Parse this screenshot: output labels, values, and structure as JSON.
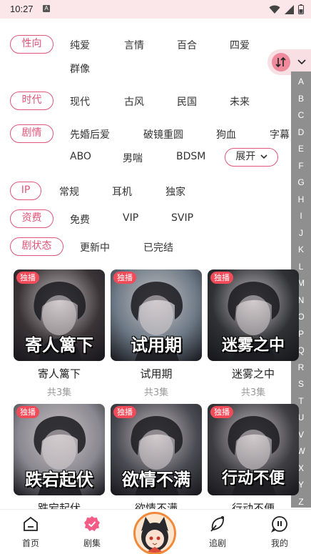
{
  "status_bar": {
    "time": "10:27",
    "notif_icon": "A"
  },
  "filters": {
    "orientation": {
      "label": "性向",
      "options": [
        "纯爱",
        "言情",
        "百合",
        "四爱",
        "群像"
      ]
    },
    "era": {
      "label": "时代",
      "options": [
        "现代",
        "古风",
        "民国",
        "未来"
      ]
    },
    "plot": {
      "label": "剧情",
      "options": [
        "先婚后爱",
        "破镜重圆",
        "狗血",
        "字幕",
        "ABO",
        "男喘",
        "BDSM"
      ],
      "expand_label": "展开"
    },
    "ip": {
      "label": "IP",
      "options": [
        "常规",
        "耳机",
        "独家"
      ]
    },
    "fee": {
      "label": "资费",
      "options": [
        "免费",
        "VIP",
        "SVIP"
      ]
    },
    "status": {
      "label": "剧状态",
      "options": [
        "更新中",
        "已完结"
      ]
    }
  },
  "alphabet": [
    "A",
    "B",
    "C",
    "D",
    "E",
    "F",
    "G",
    "H",
    "I",
    "J",
    "K",
    "L",
    "M",
    "N",
    "O",
    "P",
    "Q",
    "R",
    "S",
    "T",
    "U",
    "V",
    "W",
    "X",
    "Y",
    "Z"
  ],
  "cards": [
    {
      "badge": "独播",
      "cover_text": "寄人篱下",
      "title": "寄人篱下",
      "episodes": "共3集",
      "bg": "#3b3437"
    },
    {
      "badge": "独播",
      "cover_text": "试用期",
      "title": "试用期",
      "episodes": "共3集",
      "bg": "#6d7a86"
    },
    {
      "badge": "独播",
      "cover_text": "迷雾之中",
      "title": "迷雾之中",
      "episodes": "共3集",
      "bg": "#2f3135"
    },
    {
      "badge": "独播",
      "cover_text": "跌宕起伏",
      "title": "跌宕起伏",
      "episodes": "",
      "bg": "#8a8890"
    },
    {
      "badge": "独播",
      "cover_text": "欲情不满",
      "title": "欲情不满",
      "episodes": "",
      "bg": "#4a4a52"
    },
    {
      "badge": "独播",
      "cover_text": "行动不便",
      "title": "行动不便",
      "episodes": "",
      "bg": "#3d3d42"
    }
  ],
  "bottom_nav": [
    {
      "label": "首页",
      "icon": "home-icon"
    },
    {
      "label": "剧集",
      "icon": "badge-check-icon"
    },
    {
      "label": "",
      "icon": "avatar"
    },
    {
      "label": "追剧",
      "icon": "leaf-icon"
    },
    {
      "label": "我的",
      "icon": "profile-icon"
    }
  ],
  "colors": {
    "accent": "#e0557a",
    "badge": "#f14a58",
    "index_bg": "#8f8f8f"
  }
}
